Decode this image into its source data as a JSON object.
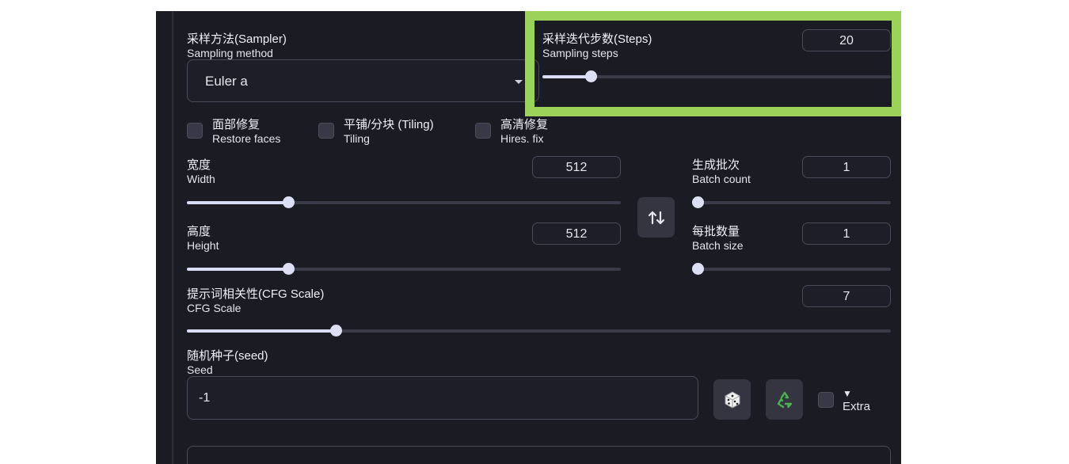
{
  "sampler": {
    "label_cn": "采样方法(Sampler)",
    "label_en": "Sampling method",
    "value": "Euler a"
  },
  "steps": {
    "label_cn": "采样迭代步数(Steps)",
    "label_en": "Sampling steps",
    "value": "20",
    "min": 1,
    "max": 150,
    "current": 20
  },
  "checkboxes": [
    {
      "cn": "面部修复",
      "en": "Restore faces",
      "checked": false
    },
    {
      "cn": "平铺/分块 (Tiling)",
      "en": "Tiling",
      "checked": false
    },
    {
      "cn": "高清修复",
      "en": "Hires. fix",
      "checked": false
    }
  ],
  "width": {
    "label_cn": "宽度",
    "label_en": "Width",
    "value": "512",
    "min": 64,
    "max": 2048,
    "current": 512
  },
  "height": {
    "label_cn": "高度",
    "label_en": "Height",
    "value": "512",
    "min": 64,
    "max": 2048,
    "current": 512
  },
  "batch_count": {
    "label_cn": "生成批次",
    "label_en": "Batch count",
    "value": "1",
    "min": 1,
    "max": 100,
    "current": 1
  },
  "batch_size": {
    "label_cn": "每批数量",
    "label_en": "Batch size",
    "value": "1",
    "min": 1,
    "max": 8,
    "current": 1
  },
  "cfg": {
    "label_cn": "提示词相关性(CFG Scale)",
    "label_en": "CFG Scale",
    "value": "7",
    "min": 1,
    "max": 30,
    "current": 7
  },
  "seed": {
    "label_cn": "随机种子(seed)",
    "label_en": "Seed",
    "value": "-1"
  },
  "extra": {
    "arrow": "▼",
    "label": "Extra"
  },
  "icons": {
    "swap": "swap-dimensions-icon",
    "dice": "dice-icon",
    "recycle": "recycle-icon"
  },
  "colors": {
    "panel_bg": "#1b1b24",
    "highlight": "#9bd35a",
    "slider_fill": "#d8dcf4"
  }
}
